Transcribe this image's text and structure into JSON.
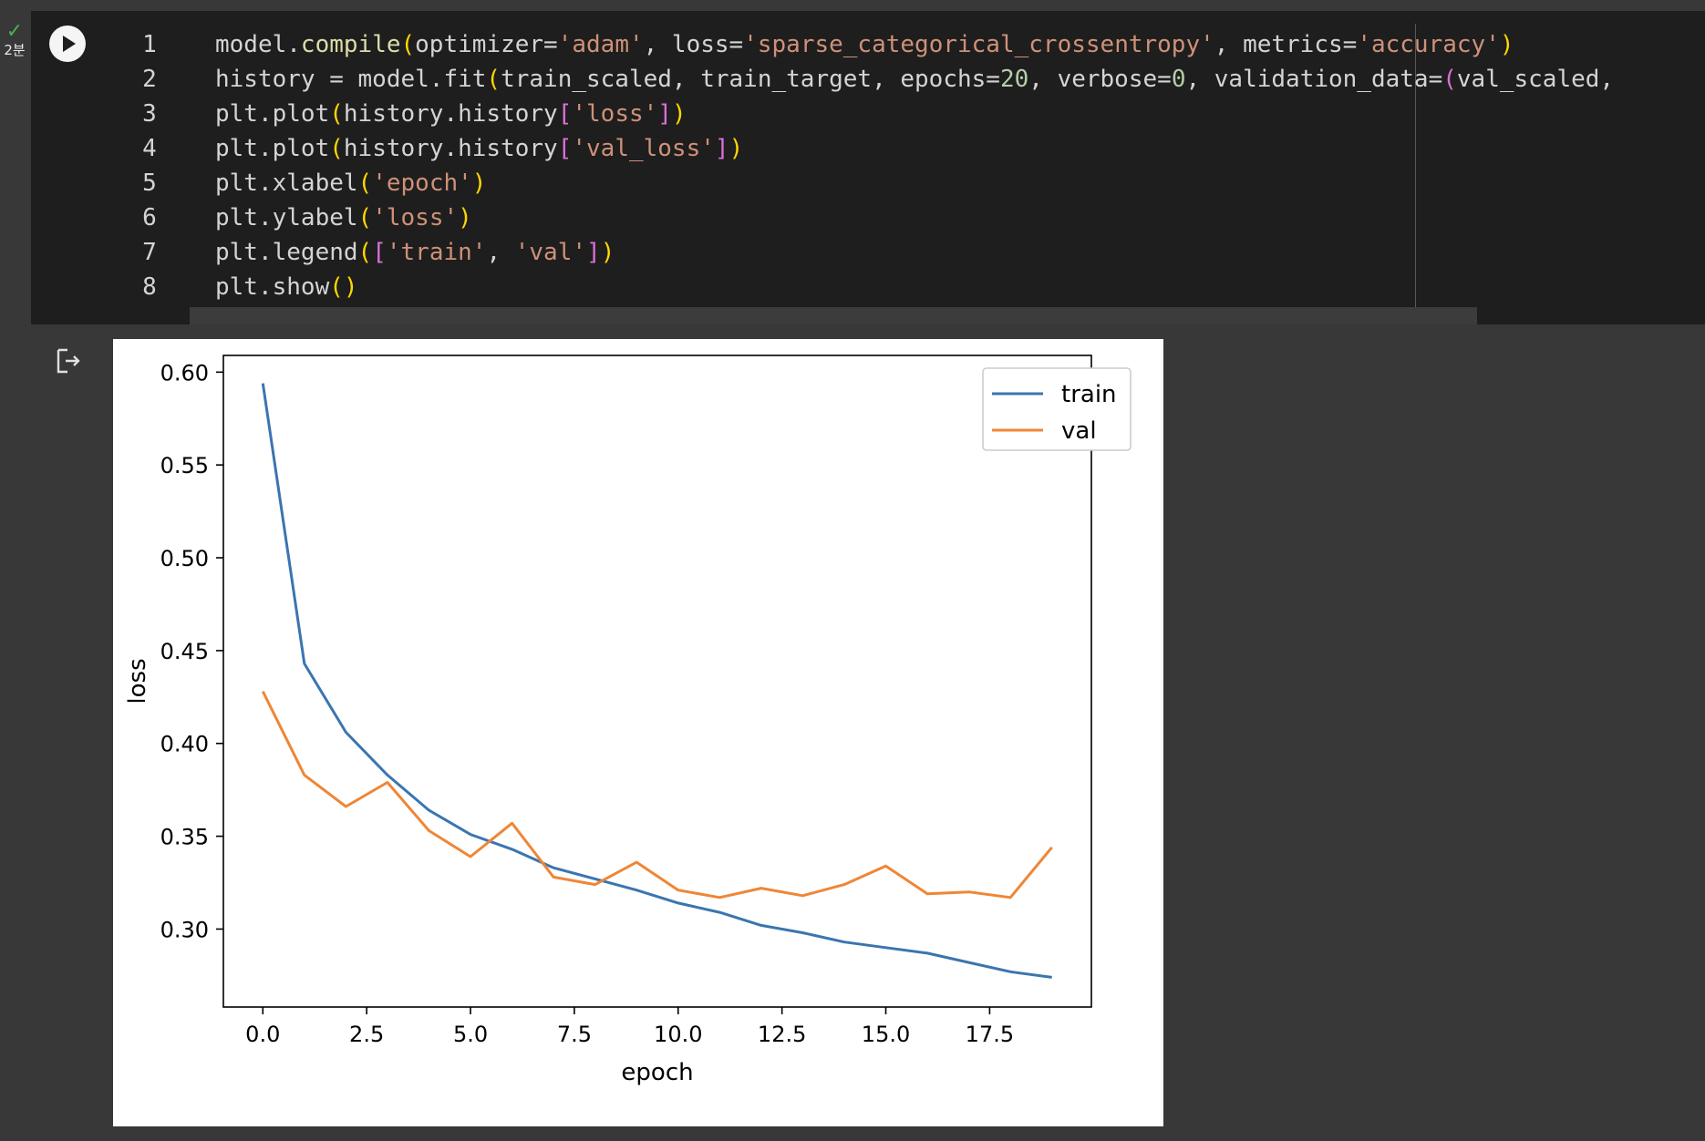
{
  "cell": {
    "exec_time": "2분",
    "status_icon": "check-icon",
    "run_button_icon": "play-icon",
    "code_lines": [
      {
        "num": "1",
        "tokens": [
          {
            "t": "model.",
            "c": "txt"
          },
          {
            "t": "compile",
            "c": "fn"
          },
          {
            "t": "(",
            "c": "p1"
          },
          {
            "t": "optimizer=",
            "c": "txt"
          },
          {
            "t": "'adam'",
            "c": "str"
          },
          {
            "t": ", loss=",
            "c": "txt"
          },
          {
            "t": "'sparse_categorical_crossentropy'",
            "c": "str"
          },
          {
            "t": ", metrics=",
            "c": "txt"
          },
          {
            "t": "'accuracy'",
            "c": "str"
          },
          {
            "t": ")",
            "c": "p1"
          }
        ]
      },
      {
        "num": "2",
        "tokens": [
          {
            "t": "history = model.fit",
            "c": "txt"
          },
          {
            "t": "(",
            "c": "p1"
          },
          {
            "t": "train_scaled, train_target, epochs=",
            "c": "txt"
          },
          {
            "t": "20",
            "c": "num"
          },
          {
            "t": ", verbose=",
            "c": "txt"
          },
          {
            "t": "0",
            "c": "num"
          },
          {
            "t": ", validation_data=",
            "c": "txt"
          },
          {
            "t": "(",
            "c": "p2"
          },
          {
            "t": "val_scaled, ",
            "c": "txt"
          }
        ]
      },
      {
        "num": "3",
        "tokens": [
          {
            "t": "plt.plot",
            "c": "txt"
          },
          {
            "t": "(",
            "c": "p1"
          },
          {
            "t": "history.history",
            "c": "txt"
          },
          {
            "t": "[",
            "c": "p2"
          },
          {
            "t": "'loss'",
            "c": "str"
          },
          {
            "t": "]",
            "c": "p2"
          },
          {
            "t": ")",
            "c": "p1"
          }
        ]
      },
      {
        "num": "4",
        "tokens": [
          {
            "t": "plt.plot",
            "c": "txt"
          },
          {
            "t": "(",
            "c": "p1"
          },
          {
            "t": "history.history",
            "c": "txt"
          },
          {
            "t": "[",
            "c": "p2"
          },
          {
            "t": "'val_loss'",
            "c": "str"
          },
          {
            "t": "]",
            "c": "p2"
          },
          {
            "t": ")",
            "c": "p1"
          }
        ]
      },
      {
        "num": "5",
        "tokens": [
          {
            "t": "plt.xlabel",
            "c": "txt"
          },
          {
            "t": "(",
            "c": "p1"
          },
          {
            "t": "'epoch'",
            "c": "str"
          },
          {
            "t": ")",
            "c": "p1"
          }
        ]
      },
      {
        "num": "6",
        "tokens": [
          {
            "t": "plt.ylabel",
            "c": "txt"
          },
          {
            "t": "(",
            "c": "p1"
          },
          {
            "t": "'loss'",
            "c": "str"
          },
          {
            "t": ")",
            "c": "p1"
          }
        ]
      },
      {
        "num": "7",
        "tokens": [
          {
            "t": "plt.legend",
            "c": "txt"
          },
          {
            "t": "(",
            "c": "p1"
          },
          {
            "t": "[",
            "c": "p2"
          },
          {
            "t": "'train'",
            "c": "str"
          },
          {
            "t": ", ",
            "c": "txt"
          },
          {
            "t": "'val'",
            "c": "str"
          },
          {
            "t": "]",
            "c": "p2"
          },
          {
            "t": ")",
            "c": "p1"
          }
        ]
      },
      {
        "num": "8",
        "tokens": [
          {
            "t": "plt.show",
            "c": "txt"
          },
          {
            "t": "(",
            "c": "p1"
          },
          {
            "t": ")",
            "c": "p1"
          }
        ]
      }
    ]
  },
  "output": {
    "icon": "output-redirect-icon"
  },
  "colors": {
    "train": "#3a75b0",
    "val": "#ef8636",
    "axis": "#000000"
  },
  "chart_data": {
    "type": "line",
    "xlabel": "epoch",
    "ylabel": "loss",
    "x": [
      0,
      1,
      2,
      3,
      4,
      5,
      6,
      7,
      8,
      9,
      10,
      11,
      12,
      13,
      14,
      15,
      16,
      17,
      18,
      19
    ],
    "xlim": [
      -0.95,
      19.95
    ],
    "ylim": [
      0.258,
      0.609
    ],
    "xticks": [
      0.0,
      2.5,
      5.0,
      7.5,
      10.0,
      12.5,
      15.0,
      17.5
    ],
    "xtick_labels": [
      "0.0",
      "2.5",
      "5.0",
      "7.5",
      "10.0",
      "12.5",
      "15.0",
      "17.5"
    ],
    "yticks": [
      0.3,
      0.35,
      0.4,
      0.45,
      0.5,
      0.55,
      0.6
    ],
    "ytick_labels": [
      "0.30",
      "0.35",
      "0.40",
      "0.45",
      "0.50",
      "0.55",
      "0.60"
    ],
    "legend_position": "top-right",
    "grid": false,
    "series": [
      {
        "name": "train",
        "values": [
          0.594,
          0.443,
          0.406,
          0.383,
          0.364,
          0.351,
          0.343,
          0.333,
          0.327,
          0.321,
          0.314,
          0.309,
          0.302,
          0.298,
          0.293,
          0.29,
          0.287,
          0.282,
          0.277,
          0.274
        ]
      },
      {
        "name": "val",
        "values": [
          0.428,
          0.383,
          0.366,
          0.379,
          0.353,
          0.339,
          0.357,
          0.328,
          0.324,
          0.336,
          0.321,
          0.317,
          0.322,
          0.318,
          0.324,
          0.334,
          0.319,
          0.32,
          0.317,
          0.344
        ]
      }
    ]
  }
}
